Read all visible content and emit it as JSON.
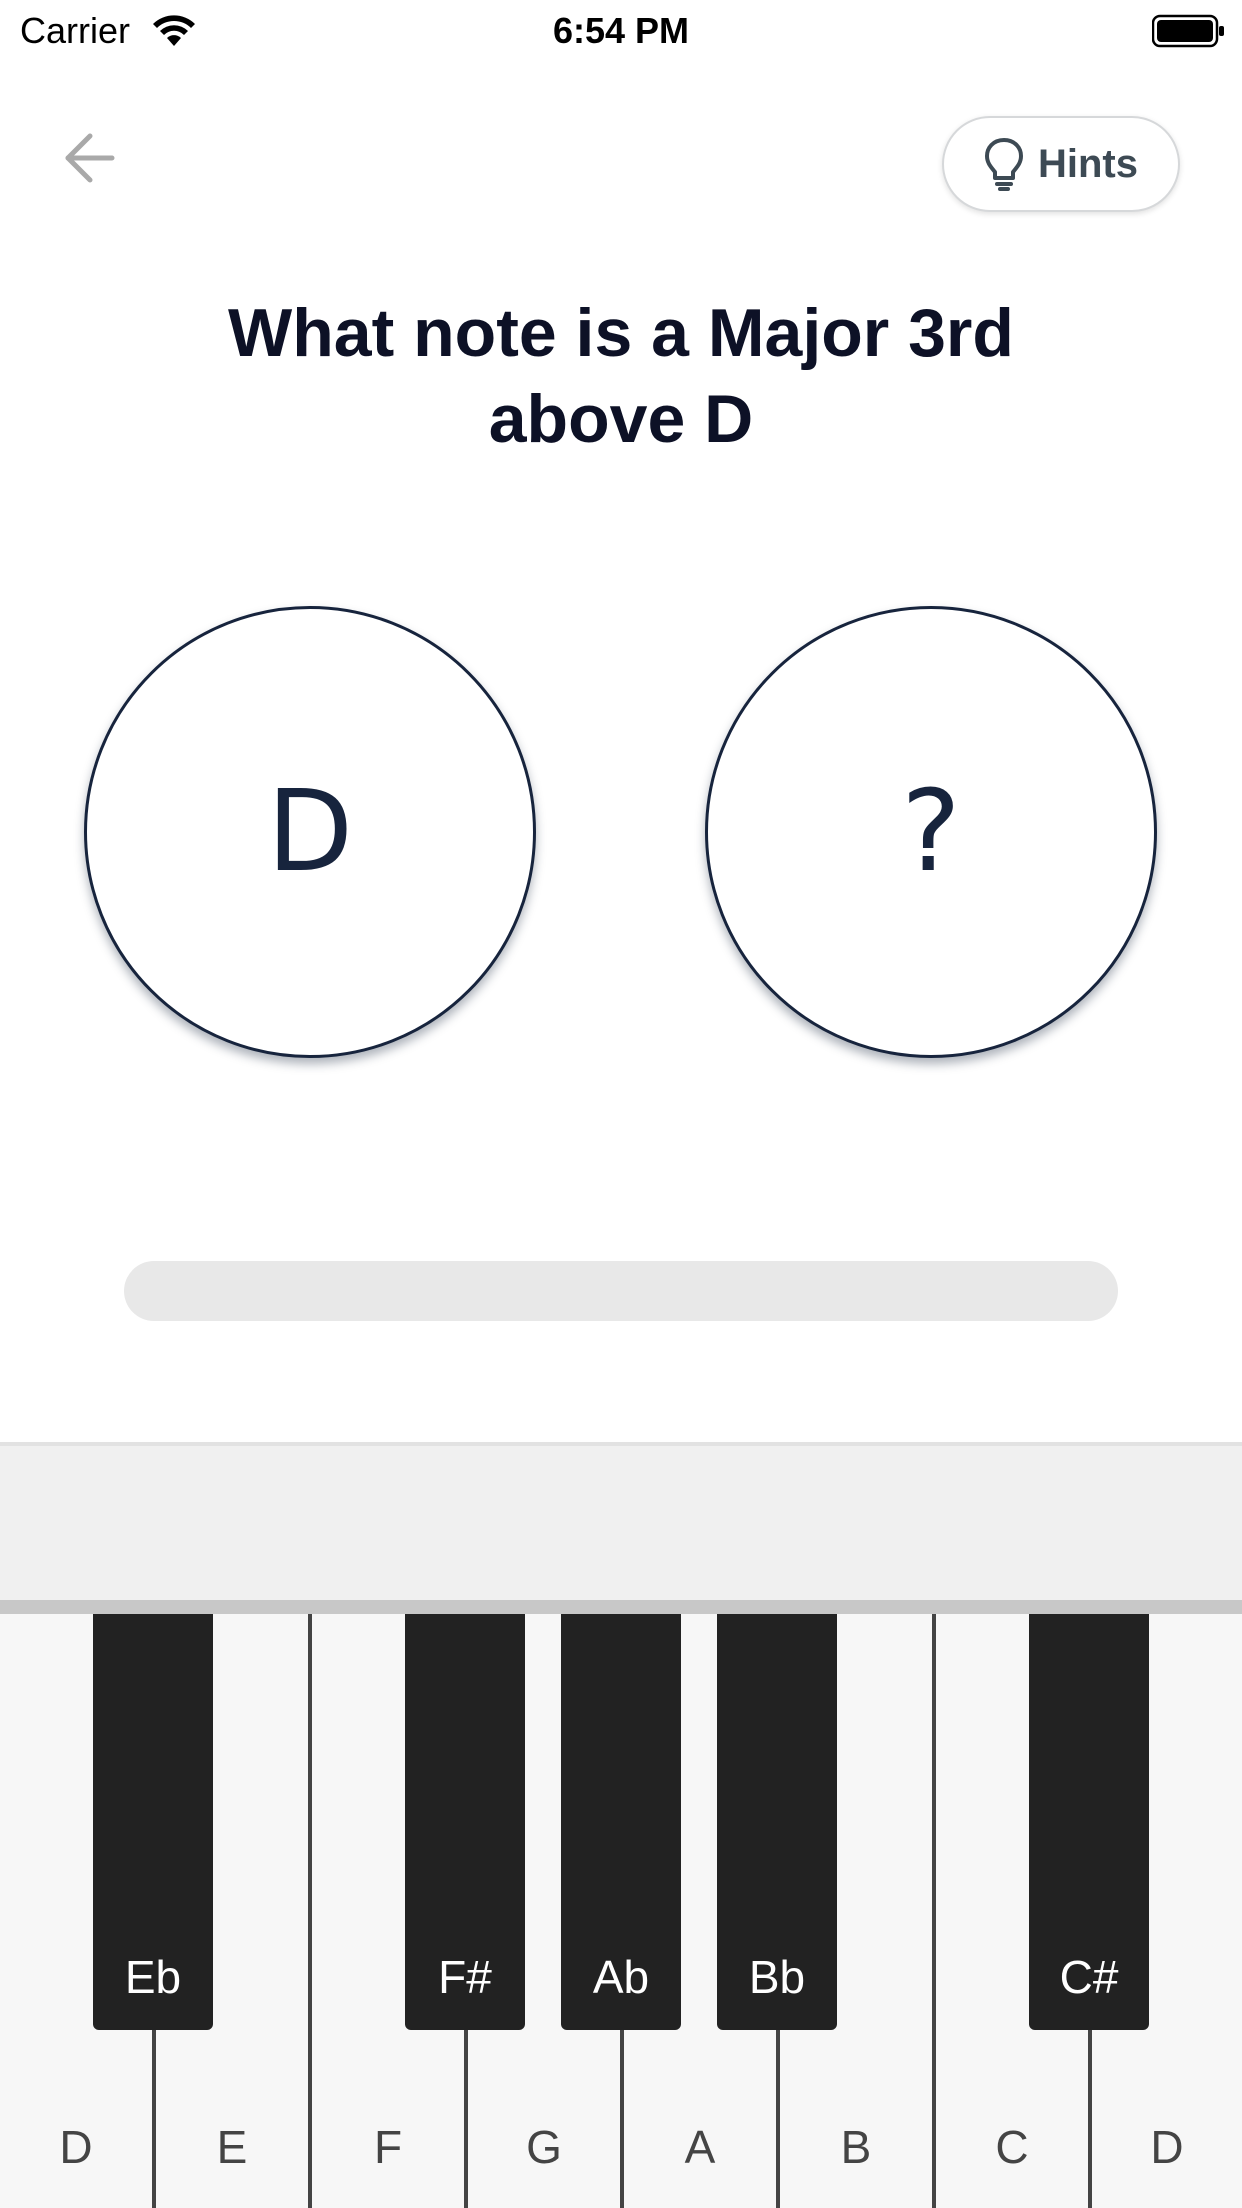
{
  "status_bar": {
    "carrier": "Carrier",
    "time": "6:54 PM",
    "icons": [
      "wifi-icon",
      "battery-icon"
    ]
  },
  "nav": {
    "back_icon": "arrow-left-icon",
    "hints_label": "Hints",
    "hints_icon": "lightbulb-icon"
  },
  "question": {
    "line1": "What note is a Major 3rd",
    "line2": "above D"
  },
  "notes": {
    "root": "D",
    "answer": "?"
  },
  "progress": {
    "value": 0
  },
  "piano": {
    "white_keys": [
      "D",
      "E",
      "F",
      "G",
      "A",
      "B",
      "C",
      "D"
    ],
    "black_keys": [
      "Eb",
      "F#",
      "Ab",
      "Bb",
      "C#"
    ]
  },
  "colors": {
    "navy": "#17243d",
    "title": "#0d1126",
    "black_key": "#222222",
    "white_key": "#f7f7f7",
    "track": "#e8e8e8"
  }
}
